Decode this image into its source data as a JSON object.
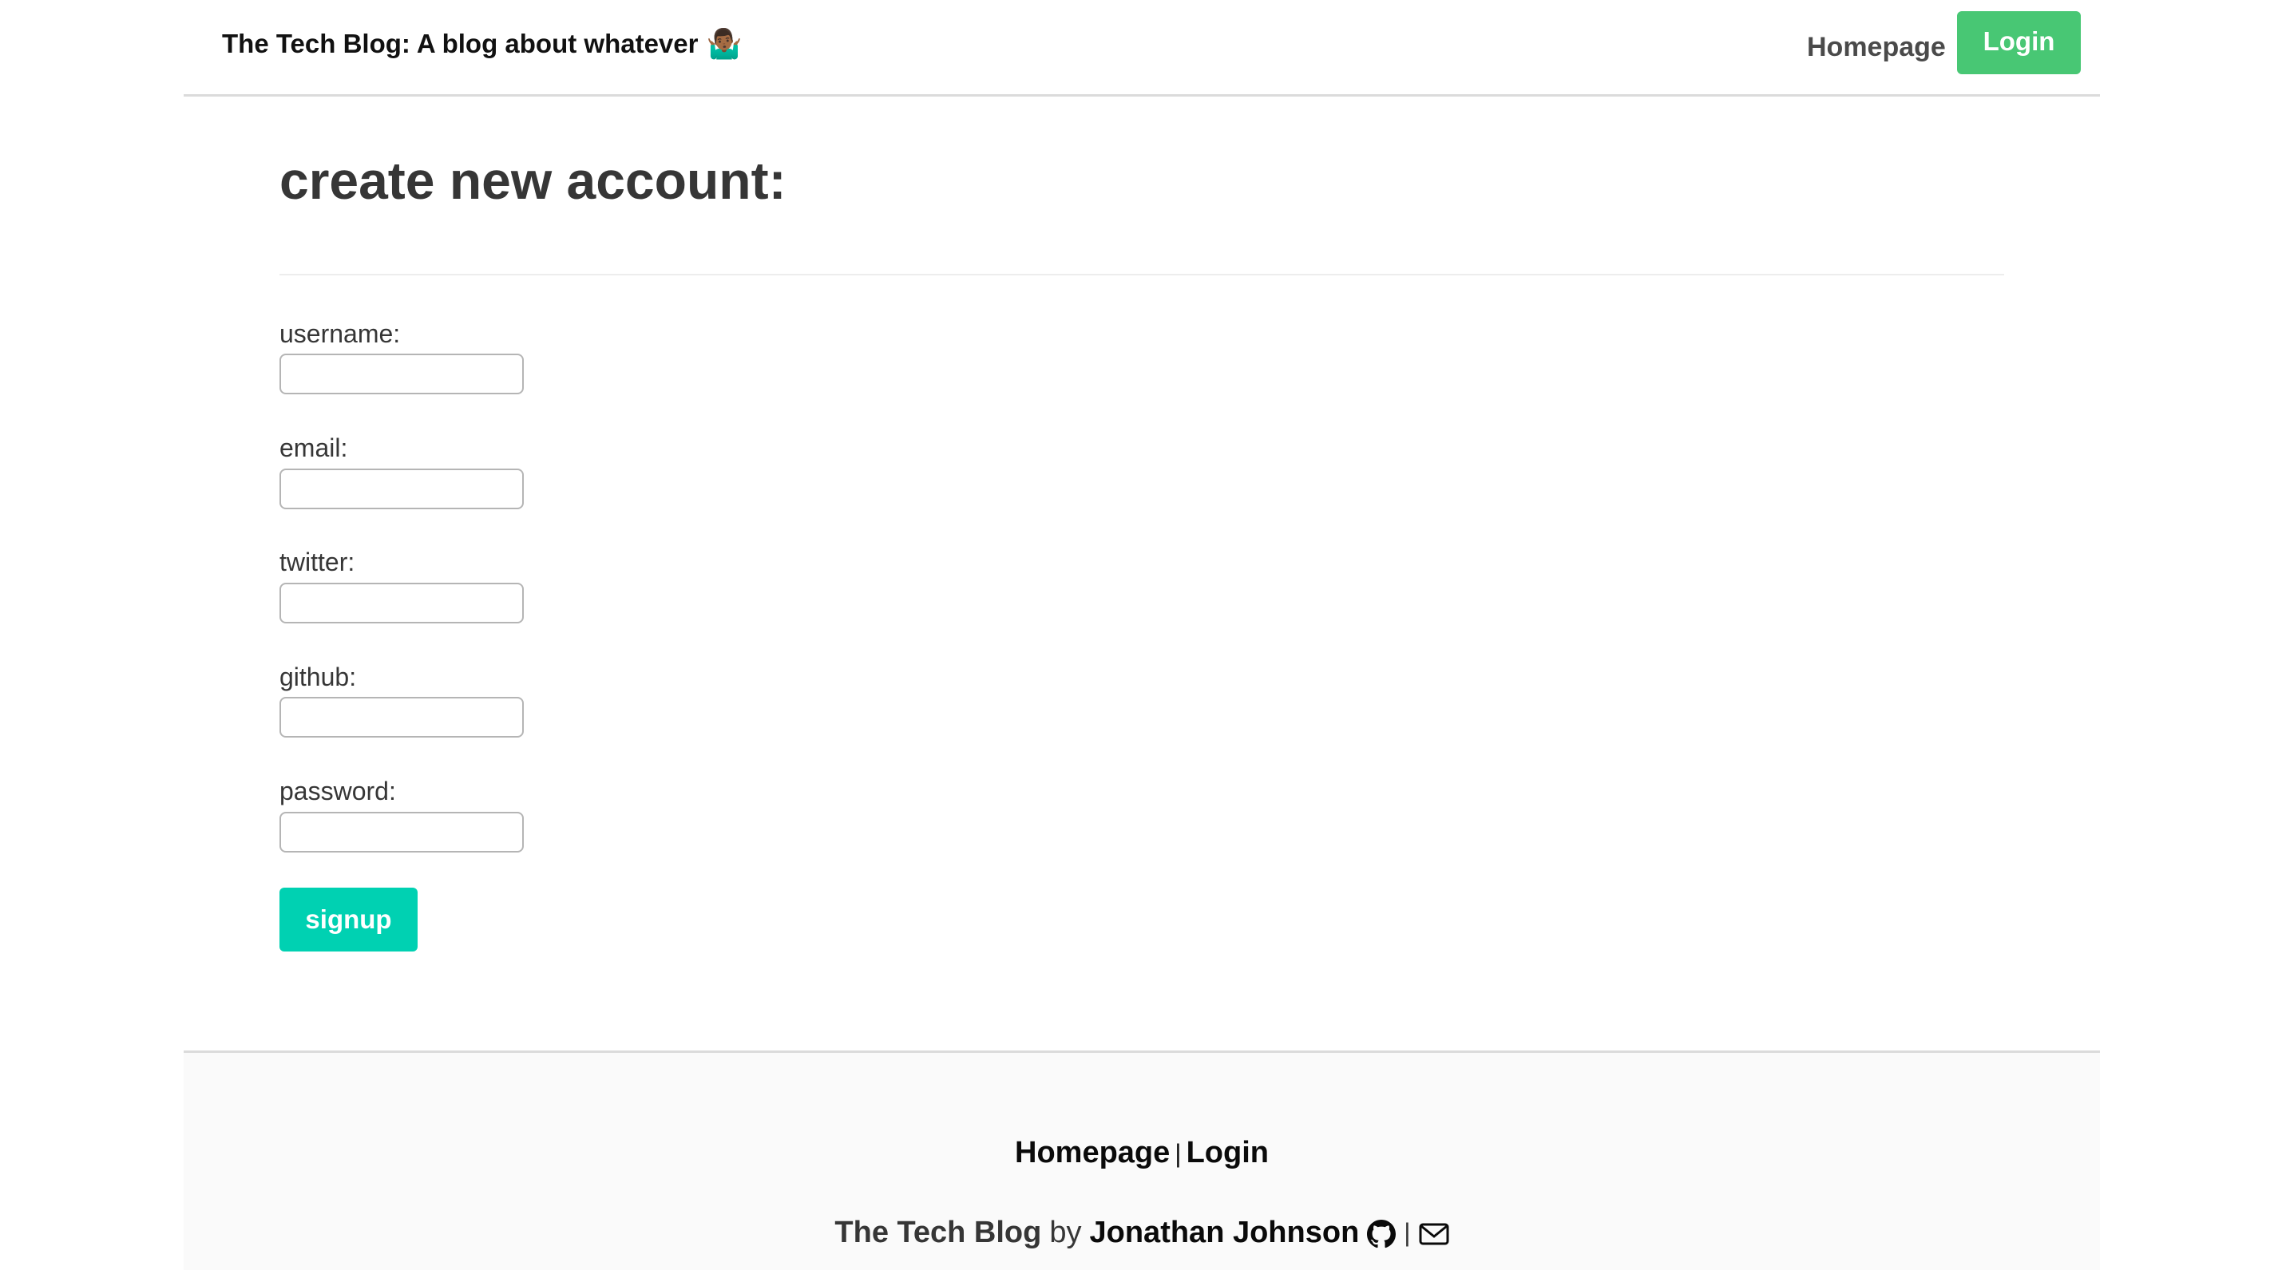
{
  "header": {
    "brand": "The Tech Blog: A blog about whatever",
    "brand_emoji": "🤷🏾‍♂️",
    "nav_homepage": "Homepage",
    "nav_login": "Login"
  },
  "main": {
    "title": "create new account:",
    "fields": [
      {
        "label": "username:",
        "value": ""
      },
      {
        "label": "email:",
        "value": ""
      },
      {
        "label": "twitter:",
        "value": ""
      },
      {
        "label": "github:",
        "value": ""
      },
      {
        "label": "password:",
        "value": ""
      }
    ],
    "signup_label": "signup"
  },
  "footer": {
    "link_homepage": "Homepage",
    "separator": "|",
    "link_login": "Login",
    "site_name": "The Tech Blog",
    "by": "by",
    "author": "Jonathan Johnson",
    "icon_separator": "|",
    "icons": [
      "github-icon",
      "envelope-icon"
    ]
  },
  "colors": {
    "login_button": "#48c774",
    "signup_button": "#00d1b2",
    "footer_background": "#fafafa"
  }
}
